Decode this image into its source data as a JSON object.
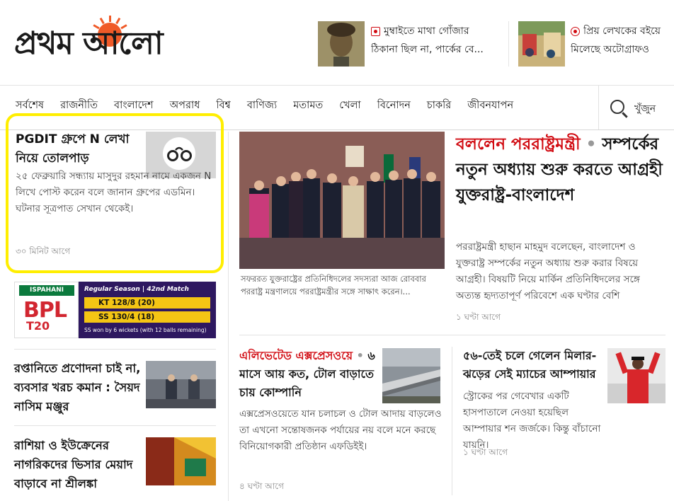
{
  "header": {
    "logo_text": "প্রথম আলো",
    "top_stories": [
      {
        "line1": "মুম্বাইতে মাথা গোঁজার",
        "line2": "ঠিকানা ছিল না, পার্কের বে..."
      },
      {
        "line1": "প্রিয় লেখকের বইয়ে",
        "line2": "মিলেছে অটোগ্রাফও"
      }
    ]
  },
  "nav": {
    "items": [
      "সর্বশেষ",
      "রাজনীতি",
      "বাংলাদেশ",
      "অপরাধ",
      "বিশ্ব",
      "বাণিজ্য",
      "মতামত",
      "খেলা",
      "বিনোদন",
      "চাকরি",
      "জীবনযাপন"
    ],
    "search_label": "খুঁজুন"
  },
  "left": {
    "highlight": {
      "title": "PGDIT গ্রুপে N লেখা নিয়ে তোলপাড়",
      "body": "২৫ ফেব্রুয়ারি সন্ধ্যায় মাসুদুর রহমান নামে একজন N লিখে পোস্ট করেন বলে জানান গ্রুপের এডমিন। ঘটনার সূত্রপাত সেখান থেকেই।",
      "time": "৩০ মিনিট আগে"
    },
    "bpl": {
      "sponsor": "ISPAHANI",
      "brand": "BPL",
      "format": "T20",
      "season": "Regular Season | 42nd Match",
      "team1": "KT 128/8 (20)",
      "team2": "SS 130/4 (18)",
      "result": "SS won by 6 wickets (with 12 balls remaining)"
    },
    "story1": {
      "title": "রপ্তানিতে প্রণোদনা চাই না, ব্যবসার খরচ কমান : সৈয়দ নাসিম মঞ্জুর"
    },
    "story2": {
      "title": "রাশিয়া ও ইউক্রেনের নাগরিকদের ভিসার মেয়াদ বাড়াবে না শ্রীলঙ্কা"
    }
  },
  "lead": {
    "caption": "সফররত যুক্তরাষ্ট্রের প্রতিনিধিদলের সদস্যরা আজ রোববার পররাষ্ট্র মন্ত্রণালয়ে পররাষ্ট্রমন্ত্রীর সঙ্গে সাক্ষাৎ করেন।...",
    "kicker": "বললেন পররাষ্ট্রমন্ত্রী",
    "title": "সম্পর্কের নতুন অধ্যায় শুরু করতে আগ্রহী যুক্তরাষ্ট্র-বাংলাদেশ",
    "body": "পররাষ্ট্রমন্ত্রী হাছান মাহমুদ বলেছেন, বাংলাদেশ ও যুক্তরাষ্ট্র সম্পর্কের নতুন অধ্যায় শুরু করার বিষয়ে আগ্রহী। বিষয়টি নিয়ে মার্কিন প্রতিনিধিদলের সঙ্গে অত্যন্ত হৃদ্যতাপূর্ণ পরিবেশে এক ঘণ্টার বেশি",
    "time": "১ ঘণ্টা আগে"
  },
  "sub1": {
    "kicker": "এলিভেটেড এক্সপ্রেসওয়ে",
    "title": "৬ মাসে আয় কত, টোল বাড়াতে চায় কোম্পানি",
    "body": "এক্সপ্রেসওয়েতে যান চলাচল ও টোল আদায় বাড়লেও তা এখনো সন্তোষজনক পর্যায়ের নয় বলে মনে করছে বিনিয়োগকারী প্রতিষ্ঠান এফডিইই।",
    "time": "৪ ঘণ্টা আগে"
  },
  "sub2": {
    "title": "৫৬-তেই চলে গেলেন মিলার-ঝড়ের সেই ম্যাচের আম্পায়ার",
    "body": "স্ট্রোকের পর গেবেখার একটি হাসপাতালে নেওয়া হয়েছিল আম্পায়ার শন জর্জকে। কিন্তু বাঁচানো যায়নি।",
    "time": "১ ঘণ্টা আগে"
  },
  "colors": {
    "accent_red": "#d10a11",
    "logo_sun": "#f05a28",
    "highlight_border": "#ffee00",
    "bpl_purple": "#2e1860",
    "bpl_yellow": "#f4c514"
  }
}
